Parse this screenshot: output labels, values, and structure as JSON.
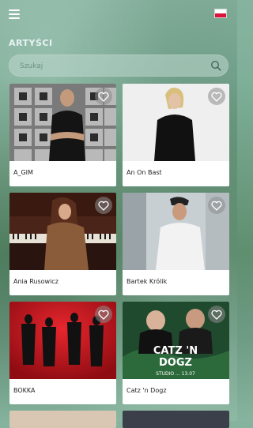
{
  "header": {
    "menu_icon": "hamburger-menu-icon",
    "language_flag": "poland-flag-icon"
  },
  "page_title": "ARTYŚCI",
  "search": {
    "placeholder": "Szukaj",
    "icon": "search-icon"
  },
  "artists": [
    {
      "name": "A_GIM",
      "favorite_icon": "heart-icon"
    },
    {
      "name": "An On Bast",
      "favorite_icon": "heart-icon"
    },
    {
      "name": "Ania Rusowicz",
      "favorite_icon": "heart-icon"
    },
    {
      "name": "Bartek Królik",
      "favorite_icon": "heart-icon"
    },
    {
      "name": "BOKKA",
      "favorite_icon": "heart-icon"
    },
    {
      "name": "Catz 'n Dogz",
      "favorite_icon": "heart-icon"
    }
  ],
  "poster_text": {
    "line1": "CATZ 'N",
    "line2": "DOGZ",
    "line3": "STUDIO ... 13.07"
  },
  "colors": {
    "accent_text": "#e8f2f5",
    "card_bg": "#ffffff",
    "flag_red": "#dc143c"
  }
}
